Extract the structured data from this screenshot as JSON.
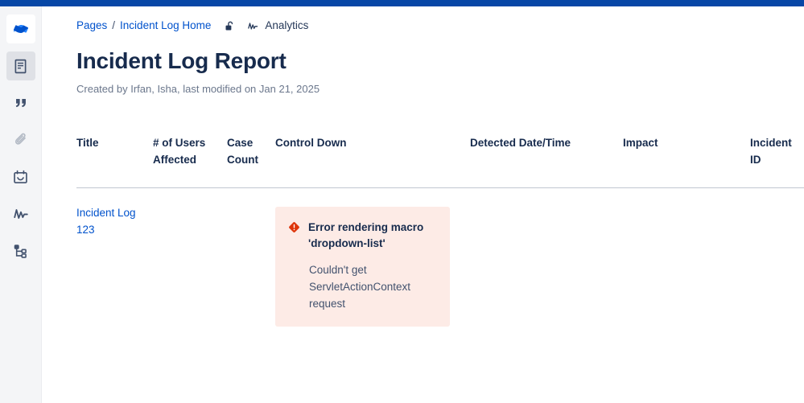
{
  "window": {
    "accent_bar_color": "#0747A6"
  },
  "sidebar": {
    "items": [
      {
        "icon": "confluence-logo-icon",
        "label": "Confluence",
        "state": "logo"
      },
      {
        "icon": "page-document-icon",
        "label": "Pages",
        "state": "active"
      },
      {
        "icon": "quote-icon",
        "label": "Blog",
        "state": "default"
      },
      {
        "icon": "paperclip-icon",
        "label": "Attachments",
        "state": "muted"
      },
      {
        "icon": "calendar-icon",
        "label": "Calendars",
        "state": "default"
      },
      {
        "icon": "analytics-pulse-icon",
        "label": "Analytics",
        "state": "default"
      },
      {
        "icon": "page-tree-icon",
        "label": "Page Tree",
        "state": "default"
      }
    ]
  },
  "breadcrumb": {
    "items": [
      {
        "label": "Pages",
        "link": true
      },
      {
        "label": "Incident Log Home",
        "link": true
      }
    ],
    "separator": "/",
    "lock_icon": "unlocked-padlock-icon",
    "analytics": {
      "icon": "analytics-pulse-icon",
      "label": "Analytics"
    }
  },
  "page": {
    "title": "Incident Log Report",
    "meta": "Created by Irfan, Isha, last modified on Jan 21, 2025"
  },
  "table": {
    "columns": [
      "Title",
      "# of Users Affected",
      "Case Count",
      "Control Down",
      "Detected Date/Time",
      "Impact",
      "Incident ID"
    ],
    "rows": [
      {
        "title": "Incident Log 123",
        "users_affected": "",
        "case_count": "",
        "control_down": {
          "type": "macro-error",
          "icon": "error-diamond-icon",
          "title": "Error rendering macro 'dropdown-list'",
          "message": "Couldn't get ServletActionContext request",
          "background_color": "#FDEBE6",
          "icon_color": "#DE350B"
        },
        "detected_date_time": "",
        "impact": "",
        "incident_id": ""
      }
    ]
  }
}
